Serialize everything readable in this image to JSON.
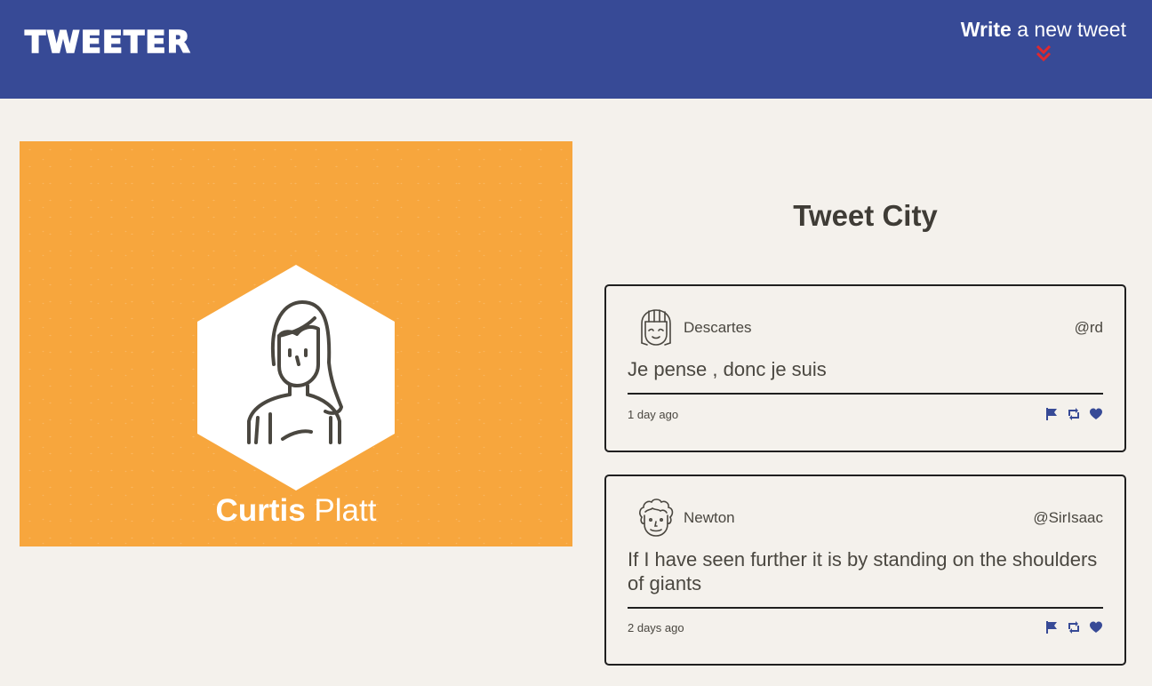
{
  "nav": {
    "brand": "TWEETER",
    "write_bold": "Write",
    "write_rest": " a new tweet",
    "write_icon": "double-chevron-down-icon",
    "accent": "#e0282e"
  },
  "profile": {
    "first_name": "Curtis",
    "last_name": " Platt",
    "background": "#f7a63d",
    "avatar_icon": "woman-avatar-icon"
  },
  "feed": {
    "title": "Tweet City",
    "tweets": [
      {
        "name": "Descartes",
        "handle": "@rd",
        "text": "Je pense , donc je suis",
        "time": "1 day ago",
        "avatar_icon": "girl-avatar-icon"
      },
      {
        "name": "Newton",
        "handle": "@SirIsaac",
        "text": "If I have seen further it is by standing on the shoulders of giants",
        "time": "2 days ago",
        "avatar_icon": "curly-hair-avatar-icon"
      }
    ],
    "action_icons": [
      "flag-icon",
      "retweet-icon",
      "heart-icon"
    ],
    "action_color": "#374a96"
  },
  "colors": {
    "nav_bg": "#374a96",
    "page_bg": "#f4f1ec",
    "text": "#4a4740"
  }
}
